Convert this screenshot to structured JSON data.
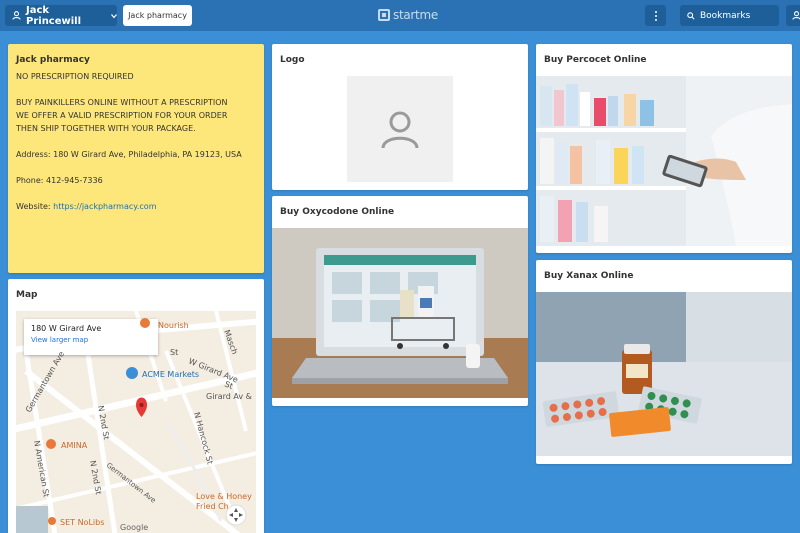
{
  "topbar": {
    "user_name": "Jack Princewill",
    "page_tab": "Jack pharmacy",
    "brand": "startme",
    "search_placeholder": "Bookmarks"
  },
  "info_card": {
    "title": "Jack pharmacy",
    "line1": "NO PRESCRIPTION REQUIRED",
    "line2": "BUY PAINKILLERS ONLINE WITHOUT A PRESCRIPTION",
    "line3": "WE OFFER A VALID PRESCRIPTION FOR YOUR ORDER",
    "line4": "THEN SHIP TOGETHER WITH YOUR PACKAGE.",
    "address": "Address: 180 W Girard Ave, Philadelphia, PA 19123, USA",
    "phone": "Phone: 412-945-7336",
    "website_label": "Website: ",
    "website_url": "https://jackpharmacy.com"
  },
  "map_card": {
    "title": "Map",
    "popup_address": "180 W Girard Ave",
    "popup_link": "View larger map",
    "streets": {
      "germantown_ave": "Germantown Ave",
      "germantown_ave_2": "Germantown Ave",
      "american_st": "N American St",
      "n2nd_st": "N 2nd St",
      "n2nd_st_2": "N 2nd St",
      "w_girard": "W Girard Ave",
      "girard_av": "Girard Av &",
      "n_hancock": "N Hancock St",
      "st_top": "St",
      "st_mid": "St",
      "masch": "Masch"
    },
    "places": {
      "acme": "ACME Markets",
      "amina": "AMINA",
      "nourish": "Nourish",
      "love_honey": "Love & Honey",
      "fried_ch": "Fried Ch...",
      "set_nolibs": "SET NoLibs"
    },
    "attribution": "Google"
  },
  "logo_card": {
    "title": "Logo"
  },
  "oxy_card": {
    "title": "Buy Oxycodone Online"
  },
  "perc_card": {
    "title": "Buy Percocet Online"
  },
  "xanax_card": {
    "title": "Buy Xanax Online"
  },
  "icons": [
    "user-icon",
    "chevron-down-icon",
    "startme-logo-icon",
    "kebab-menu-icon",
    "search-icon",
    "profile-icon",
    "map-pin-icon",
    "placeholder-user-icon",
    "compass-icon"
  ],
  "colors": {
    "background": "#3b8fd6",
    "topbar": "#2a72b4",
    "note_yellow": "#fde77a",
    "link_blue": "#1b6fb8",
    "map_pin": "#e53935"
  }
}
